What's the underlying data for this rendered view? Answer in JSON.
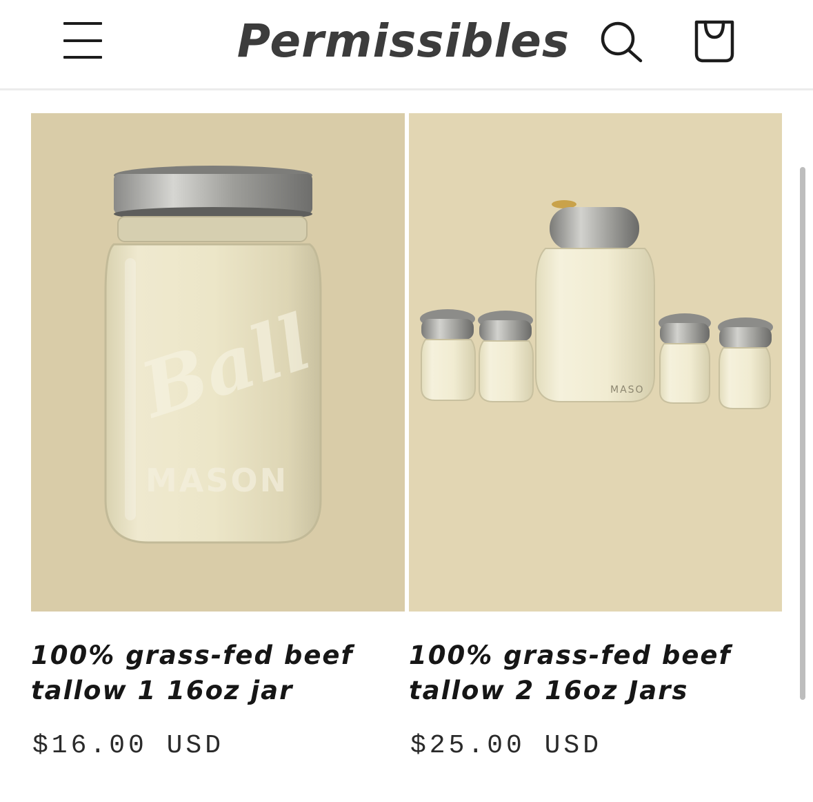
{
  "header": {
    "brand": "Permissibles",
    "icons": {
      "menu": "hamburger-menu-icon",
      "search": "search-icon",
      "cart": "shopping-bag-icon"
    }
  },
  "products": [
    {
      "title": "100% grass-fed beef tallow 1 16oz jar",
      "price": "$16.00 USD",
      "image_text": "Ball MASON",
      "image_bg": "#d9cca8"
    },
    {
      "title": "100% grass-fed beef tallow 2 16oz Jars",
      "price": "$25.00 USD",
      "image_text": "MASO",
      "image_bg": "#e2d6b3"
    }
  ]
}
